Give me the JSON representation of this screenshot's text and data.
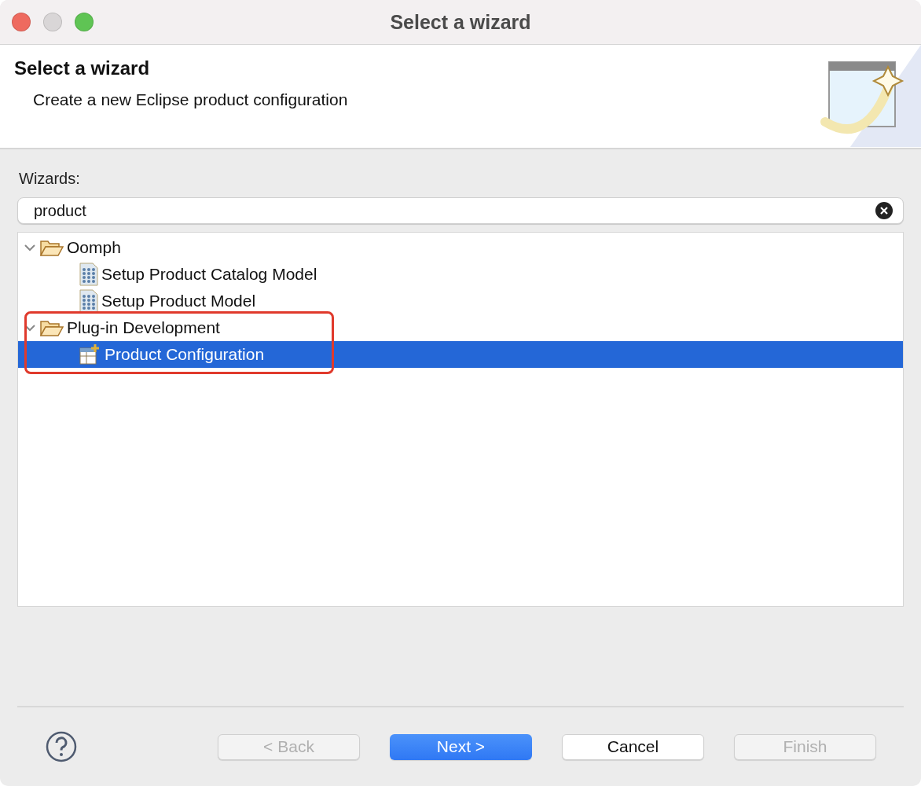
{
  "window": {
    "title": "Select a wizard"
  },
  "header": {
    "title": "Select a wizard",
    "description": "Create a new Eclipse product configuration"
  },
  "wizards_label": "Wizards:",
  "search": {
    "value": "product"
  },
  "tree": [
    {
      "label": "Oomph",
      "kind": "folder",
      "expanded": true,
      "selected": false,
      "highlighted": false,
      "children": [
        {
          "label": "Setup Product Catalog Model",
          "kind": "model",
          "selected": false
        },
        {
          "label": "Setup Product Model",
          "kind": "model",
          "selected": false
        }
      ]
    },
    {
      "label": "Plug-in Development",
      "kind": "folder",
      "expanded": true,
      "selected": false,
      "highlighted": true,
      "children": [
        {
          "label": "Product Configuration",
          "kind": "product",
          "selected": true
        }
      ]
    }
  ],
  "buttons": [
    {
      "label": "< Back",
      "kind": "normal",
      "disabled": true
    },
    {
      "label": "Next >",
      "kind": "default",
      "disabled": false
    },
    {
      "label": "Cancel",
      "kind": "normal",
      "disabled": false
    },
    {
      "label": "Finish",
      "kind": "normal",
      "disabled": true
    }
  ]
}
